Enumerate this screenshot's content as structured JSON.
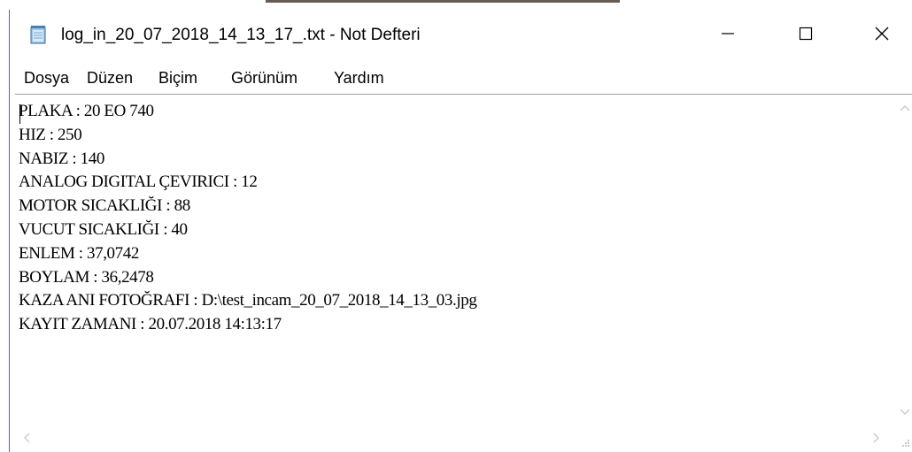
{
  "window": {
    "title": "log_in_20_07_2018_14_13_17_.txt - Not Defteri"
  },
  "icons": {
    "app": "notepad-icon",
    "minimize": "minimize-icon",
    "maximize": "maximize-icon",
    "close": "close-icon"
  },
  "menu": {
    "items": [
      {
        "label": "Dosya"
      },
      {
        "label": "Düzen"
      },
      {
        "label": "Biçim"
      },
      {
        "label": "Görünüm"
      },
      {
        "label": "Yardım"
      }
    ]
  },
  "document": {
    "lines": [
      "PLAKA : 20 EO 740",
      "HIZ : 250",
      "NABIZ : 140",
      "ANALOG DIGITAL ÇEVIRICI : 12",
      "MOTOR SICAKLIĞI : 88",
      "VUCUT SICAKLIĞI : 40",
      "ENLEM : 37,0742",
      "BOYLAM : 36,2478",
      "KAZA ANI FOTOĞRAFI : D:\\test_incam_20_07_2018_14_13_03.jpg",
      "KAYIT ZAMANI : 20.07.2018 14:13:17"
    ]
  },
  "colors": {
    "border_accent": "#3b6ea8",
    "text": "#000000",
    "scroll_arrow": "#c8c8c8"
  }
}
